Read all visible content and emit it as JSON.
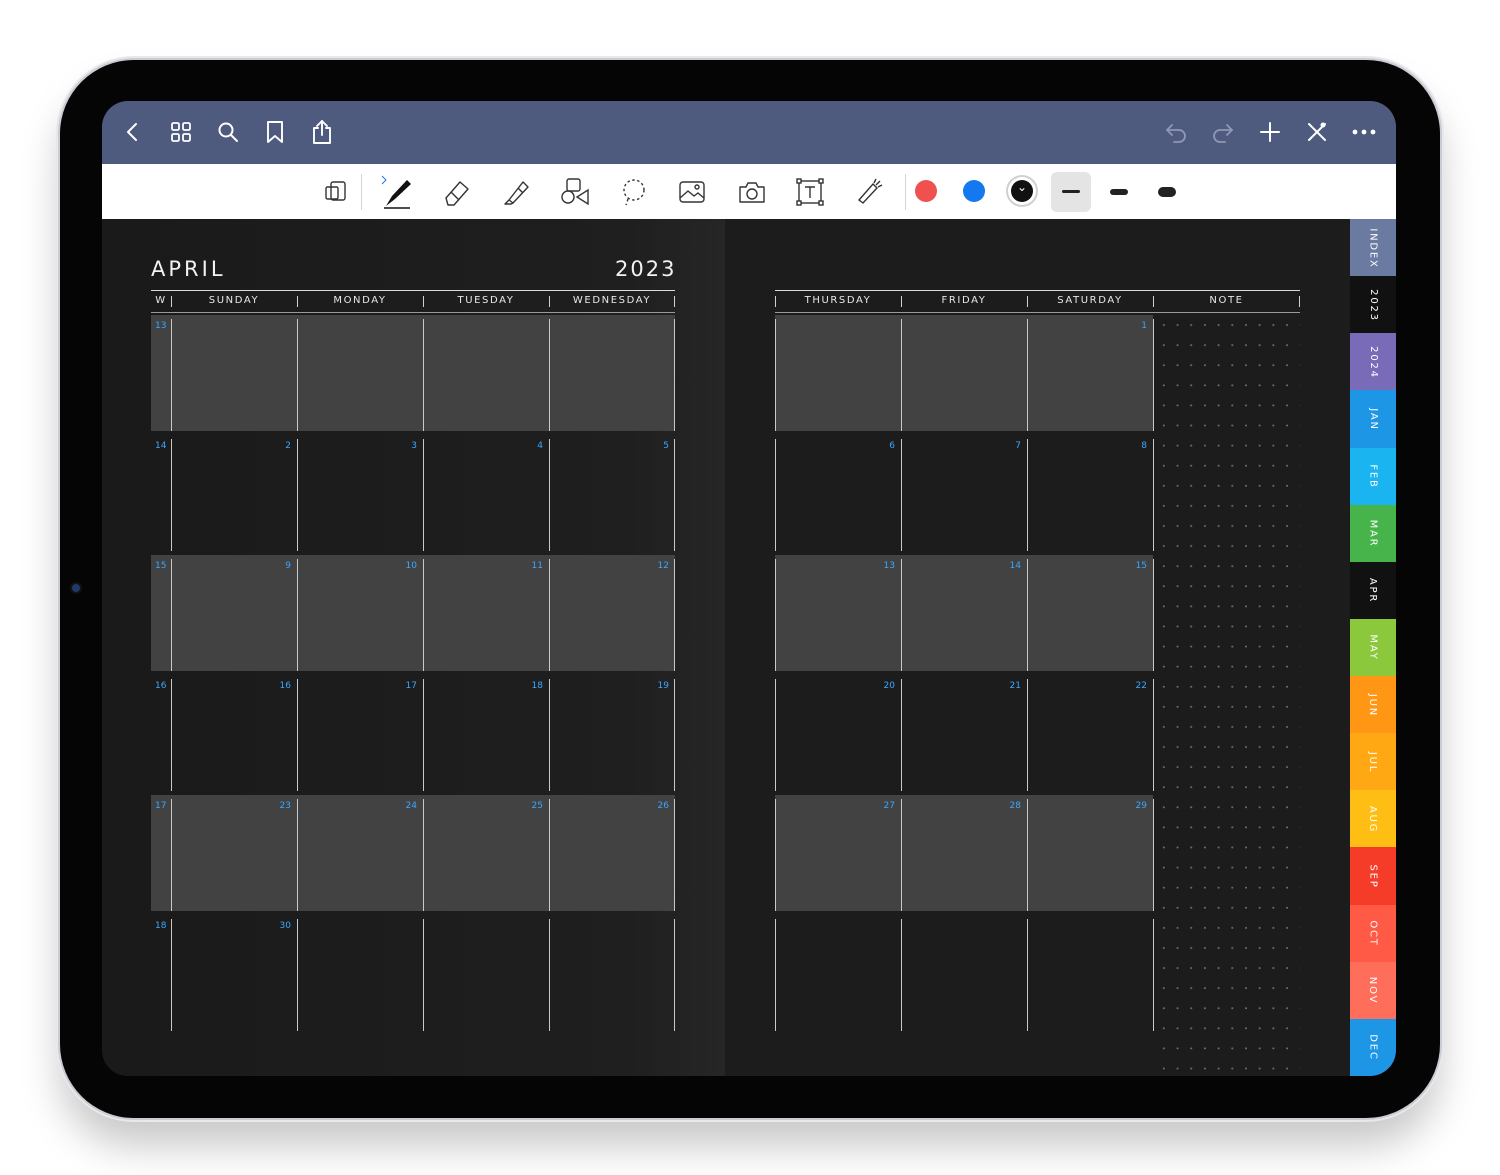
{
  "toolbar": {
    "nav_icons": [
      "back-icon",
      "grid-icon",
      "search-icon",
      "bookmark-icon",
      "share-icon"
    ],
    "right_icons": [
      "undo-icon",
      "redo-icon",
      "add-icon",
      "close-icon",
      "more-icon"
    ],
    "tools": [
      "page-view-icon",
      "pen-icon",
      "eraser-icon",
      "highlighter-icon",
      "shapes-icon",
      "lasso-icon",
      "image-icon",
      "camera-icon",
      "text-icon",
      "laser-icon"
    ],
    "colors": [
      "#f05050",
      "#1478f0",
      "#111111"
    ],
    "stroke_widths": [
      "thin",
      "medium",
      "thick"
    ]
  },
  "calendar": {
    "month": "APRIL",
    "year": "2023",
    "left_headers": [
      "W",
      "SUNDAY",
      "MONDAY",
      "TUESDAY",
      "WEDNESDAY"
    ],
    "right_headers": [
      "THURSDAY",
      "FRIDAY",
      "SATURDAY",
      "NOTE"
    ],
    "weeks": [
      {
        "w": "13",
        "days": [
          "",
          "",
          "",
          "",
          "",
          "",
          "1"
        ]
      },
      {
        "w": "14",
        "days": [
          "2",
          "3",
          "4",
          "5",
          "6",
          "7",
          "8"
        ]
      },
      {
        "w": "15",
        "days": [
          "9",
          "10",
          "11",
          "12",
          "13",
          "14",
          "15"
        ]
      },
      {
        "w": "16",
        "days": [
          "16",
          "17",
          "18",
          "19",
          "20",
          "21",
          "22"
        ]
      },
      {
        "w": "17",
        "days": [
          "23",
          "24",
          "25",
          "26",
          "27",
          "28",
          "29"
        ]
      },
      {
        "w": "18",
        "days": [
          "30",
          "",
          "",
          "",
          "",
          "",
          ""
        ]
      }
    ]
  },
  "tabs": [
    {
      "label": "INDEX",
      "color": "#6b7aa1"
    },
    {
      "label": "2023",
      "color": "#111111"
    },
    {
      "label": "2024",
      "color": "#7a6bb8"
    },
    {
      "label": "JAN",
      "color": "#1e96e6"
    },
    {
      "label": "FEB",
      "color": "#1ab4f0"
    },
    {
      "label": "MAR",
      "color": "#46b44a"
    },
    {
      "label": "APR",
      "color": "#111111"
    },
    {
      "label": "MAY",
      "color": "#8cc83c"
    },
    {
      "label": "JUN",
      "color": "#ff9614"
    },
    {
      "label": "JUL",
      "color": "#ffa814"
    },
    {
      "label": "AUG",
      "color": "#ffbe14"
    },
    {
      "label": "SEP",
      "color": "#f53c28"
    },
    {
      "label": "OCT",
      "color": "#ff5a46"
    },
    {
      "label": "NOV",
      "color": "#ff6e5a"
    },
    {
      "label": "DEC",
      "color": "#1e96e6"
    }
  ]
}
